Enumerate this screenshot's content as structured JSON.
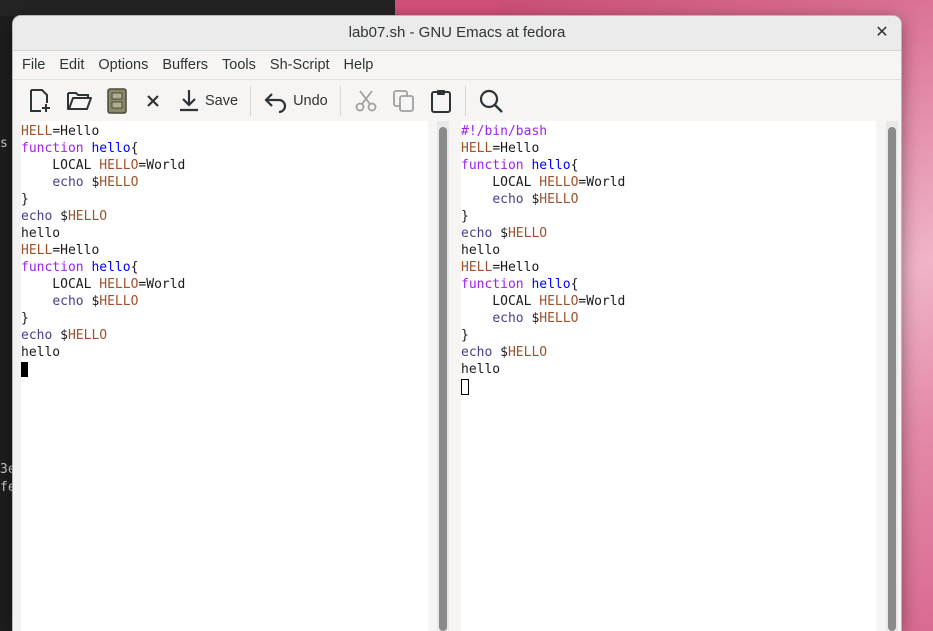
{
  "window": {
    "title": "lab07.sh - GNU Emacs at fedora",
    "close_glyph": "✕"
  },
  "menu": [
    "File",
    "Edit",
    "Options",
    "Buffers",
    "Tools",
    "Sh-Script",
    "Help"
  ],
  "toolbar": {
    "save_label": "Save",
    "undo_label": "Undo"
  },
  "background": {
    "terminal_fragments": [
      "s",
      "3e",
      "fe"
    ]
  },
  "left_buffer": {
    "lines": [
      [
        [
          "var",
          "HELL"
        ],
        [
          "plain",
          "=Hello"
        ]
      ],
      [
        [
          "kw",
          "function"
        ],
        [
          "plain",
          " "
        ],
        [
          "fn",
          "hello"
        ],
        [
          "plain",
          "{"
        ]
      ],
      [
        [
          "plain",
          "    LOCAL "
        ],
        [
          "var",
          "HELLO"
        ],
        [
          "plain",
          "=World"
        ]
      ],
      [
        [
          "plain",
          "    "
        ],
        [
          "bi",
          "echo"
        ],
        [
          "plain",
          " $"
        ],
        [
          "var",
          "HELLO"
        ]
      ],
      [
        [
          "plain",
          "}"
        ]
      ],
      [
        [
          "bi",
          "echo"
        ],
        [
          "plain",
          " $"
        ],
        [
          "var",
          "HELLO"
        ]
      ],
      [
        [
          "plain",
          "hello"
        ]
      ],
      [
        [
          "var",
          "HELL"
        ],
        [
          "plain",
          "=Hello"
        ]
      ],
      [
        [
          "kw",
          "function"
        ],
        [
          "plain",
          " "
        ],
        [
          "fn",
          "hello"
        ],
        [
          "plain",
          "{"
        ]
      ],
      [
        [
          "plain",
          "    LOCAL "
        ],
        [
          "var",
          "HELLO"
        ],
        [
          "plain",
          "=World"
        ]
      ],
      [
        [
          "plain",
          "    "
        ],
        [
          "bi",
          "echo"
        ],
        [
          "plain",
          " $"
        ],
        [
          "var",
          "HELLO"
        ]
      ],
      [
        [
          "plain",
          "}"
        ]
      ],
      [
        [
          "bi",
          "echo"
        ],
        [
          "plain",
          " $"
        ],
        [
          "var",
          "HELLO"
        ]
      ],
      [
        [
          "plain",
          "hello"
        ]
      ],
      [
        [
          "cursor-solid",
          ""
        ]
      ]
    ]
  },
  "right_buffer": {
    "lines": [
      [
        [
          "kw",
          "#!/bin/bash"
        ]
      ],
      [
        [
          "var",
          "HELL"
        ],
        [
          "plain",
          "=Hello"
        ]
      ],
      [
        [
          "kw",
          "function"
        ],
        [
          "plain",
          " "
        ],
        [
          "fn",
          "hello"
        ],
        [
          "plain",
          "{"
        ]
      ],
      [
        [
          "plain",
          "    LOCAL "
        ],
        [
          "var",
          "HELLO"
        ],
        [
          "plain",
          "=World"
        ]
      ],
      [
        [
          "plain",
          "    "
        ],
        [
          "bi",
          "echo"
        ],
        [
          "plain",
          " $"
        ],
        [
          "var",
          "HELLO"
        ]
      ],
      [
        [
          "plain",
          "}"
        ]
      ],
      [
        [
          "bi",
          "echo"
        ],
        [
          "plain",
          " $"
        ],
        [
          "var",
          "HELLO"
        ]
      ],
      [
        [
          "plain",
          "hello"
        ]
      ],
      [
        [
          "var",
          "HELL"
        ],
        [
          "plain",
          "=Hello"
        ]
      ],
      [
        [
          "kw",
          "function"
        ],
        [
          "plain",
          " "
        ],
        [
          "fn",
          "hello"
        ],
        [
          "plain",
          "{"
        ]
      ],
      [
        [
          "plain",
          "    LOCAL "
        ],
        [
          "var",
          "HELLO"
        ],
        [
          "plain",
          "=World"
        ]
      ],
      [
        [
          "plain",
          "    "
        ],
        [
          "bi",
          "echo"
        ],
        [
          "plain",
          " $"
        ],
        [
          "var",
          "HELLO"
        ]
      ],
      [
        [
          "plain",
          "}"
        ]
      ],
      [
        [
          "bi",
          "echo"
        ],
        [
          "plain",
          " $"
        ],
        [
          "var",
          "HELLO"
        ]
      ],
      [
        [
          "plain",
          "hello"
        ]
      ],
      [
        [
          "cursor-hollow",
          ""
        ]
      ]
    ]
  },
  "colors": {
    "keyword": "#a020f0",
    "function_name": "#0000ff",
    "variable": "#a0522d",
    "builtin": "#483d8b"
  }
}
